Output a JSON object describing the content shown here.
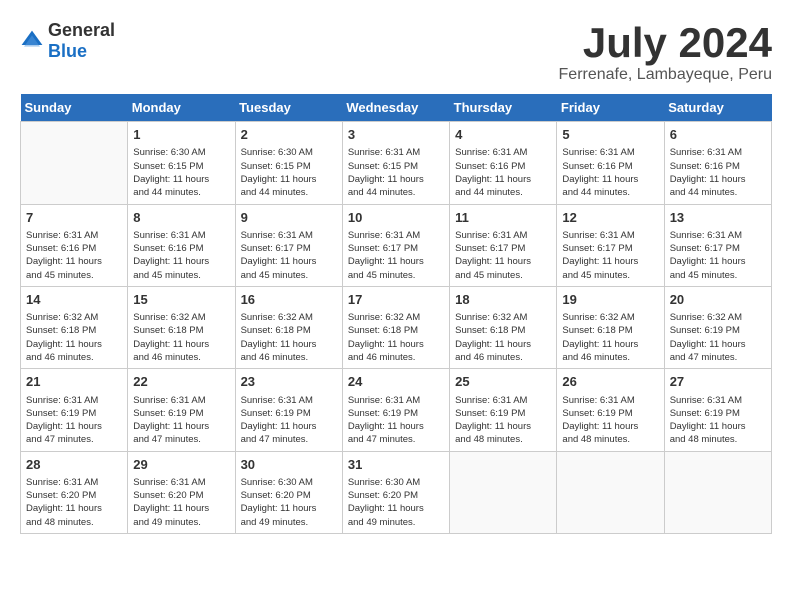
{
  "header": {
    "logo_general": "General",
    "logo_blue": "Blue",
    "month_year": "July 2024",
    "location": "Ferrenafe, Lambayeque, Peru"
  },
  "days_of_week": [
    "Sunday",
    "Monday",
    "Tuesday",
    "Wednesday",
    "Thursday",
    "Friday",
    "Saturday"
  ],
  "weeks": [
    [
      {
        "day": "",
        "info": ""
      },
      {
        "day": "1",
        "info": "Sunrise: 6:30 AM\nSunset: 6:15 PM\nDaylight: 11 hours\nand 44 minutes."
      },
      {
        "day": "2",
        "info": "Sunrise: 6:30 AM\nSunset: 6:15 PM\nDaylight: 11 hours\nand 44 minutes."
      },
      {
        "day": "3",
        "info": "Sunrise: 6:31 AM\nSunset: 6:15 PM\nDaylight: 11 hours\nand 44 minutes."
      },
      {
        "day": "4",
        "info": "Sunrise: 6:31 AM\nSunset: 6:16 PM\nDaylight: 11 hours\nand 44 minutes."
      },
      {
        "day": "5",
        "info": "Sunrise: 6:31 AM\nSunset: 6:16 PM\nDaylight: 11 hours\nand 44 minutes."
      },
      {
        "day": "6",
        "info": "Sunrise: 6:31 AM\nSunset: 6:16 PM\nDaylight: 11 hours\nand 44 minutes."
      }
    ],
    [
      {
        "day": "7",
        "info": "Sunrise: 6:31 AM\nSunset: 6:16 PM\nDaylight: 11 hours\nand 45 minutes."
      },
      {
        "day": "8",
        "info": "Sunrise: 6:31 AM\nSunset: 6:16 PM\nDaylight: 11 hours\nand 45 minutes."
      },
      {
        "day": "9",
        "info": "Sunrise: 6:31 AM\nSunset: 6:17 PM\nDaylight: 11 hours\nand 45 minutes."
      },
      {
        "day": "10",
        "info": "Sunrise: 6:31 AM\nSunset: 6:17 PM\nDaylight: 11 hours\nand 45 minutes."
      },
      {
        "day": "11",
        "info": "Sunrise: 6:31 AM\nSunset: 6:17 PM\nDaylight: 11 hours\nand 45 minutes."
      },
      {
        "day": "12",
        "info": "Sunrise: 6:31 AM\nSunset: 6:17 PM\nDaylight: 11 hours\nand 45 minutes."
      },
      {
        "day": "13",
        "info": "Sunrise: 6:31 AM\nSunset: 6:17 PM\nDaylight: 11 hours\nand 45 minutes."
      }
    ],
    [
      {
        "day": "14",
        "info": "Sunrise: 6:32 AM\nSunset: 6:18 PM\nDaylight: 11 hours\nand 46 minutes."
      },
      {
        "day": "15",
        "info": "Sunrise: 6:32 AM\nSunset: 6:18 PM\nDaylight: 11 hours\nand 46 minutes."
      },
      {
        "day": "16",
        "info": "Sunrise: 6:32 AM\nSunset: 6:18 PM\nDaylight: 11 hours\nand 46 minutes."
      },
      {
        "day": "17",
        "info": "Sunrise: 6:32 AM\nSunset: 6:18 PM\nDaylight: 11 hours\nand 46 minutes."
      },
      {
        "day": "18",
        "info": "Sunrise: 6:32 AM\nSunset: 6:18 PM\nDaylight: 11 hours\nand 46 minutes."
      },
      {
        "day": "19",
        "info": "Sunrise: 6:32 AM\nSunset: 6:18 PM\nDaylight: 11 hours\nand 46 minutes."
      },
      {
        "day": "20",
        "info": "Sunrise: 6:32 AM\nSunset: 6:19 PM\nDaylight: 11 hours\nand 47 minutes."
      }
    ],
    [
      {
        "day": "21",
        "info": "Sunrise: 6:31 AM\nSunset: 6:19 PM\nDaylight: 11 hours\nand 47 minutes."
      },
      {
        "day": "22",
        "info": "Sunrise: 6:31 AM\nSunset: 6:19 PM\nDaylight: 11 hours\nand 47 minutes."
      },
      {
        "day": "23",
        "info": "Sunrise: 6:31 AM\nSunset: 6:19 PM\nDaylight: 11 hours\nand 47 minutes."
      },
      {
        "day": "24",
        "info": "Sunrise: 6:31 AM\nSunset: 6:19 PM\nDaylight: 11 hours\nand 47 minutes."
      },
      {
        "day": "25",
        "info": "Sunrise: 6:31 AM\nSunset: 6:19 PM\nDaylight: 11 hours\nand 48 minutes."
      },
      {
        "day": "26",
        "info": "Sunrise: 6:31 AM\nSunset: 6:19 PM\nDaylight: 11 hours\nand 48 minutes."
      },
      {
        "day": "27",
        "info": "Sunrise: 6:31 AM\nSunset: 6:19 PM\nDaylight: 11 hours\nand 48 minutes."
      }
    ],
    [
      {
        "day": "28",
        "info": "Sunrise: 6:31 AM\nSunset: 6:20 PM\nDaylight: 11 hours\nand 48 minutes."
      },
      {
        "day": "29",
        "info": "Sunrise: 6:31 AM\nSunset: 6:20 PM\nDaylight: 11 hours\nand 49 minutes."
      },
      {
        "day": "30",
        "info": "Sunrise: 6:30 AM\nSunset: 6:20 PM\nDaylight: 11 hours\nand 49 minutes."
      },
      {
        "day": "31",
        "info": "Sunrise: 6:30 AM\nSunset: 6:20 PM\nDaylight: 11 hours\nand 49 minutes."
      },
      {
        "day": "",
        "info": ""
      },
      {
        "day": "",
        "info": ""
      },
      {
        "day": "",
        "info": ""
      }
    ]
  ]
}
